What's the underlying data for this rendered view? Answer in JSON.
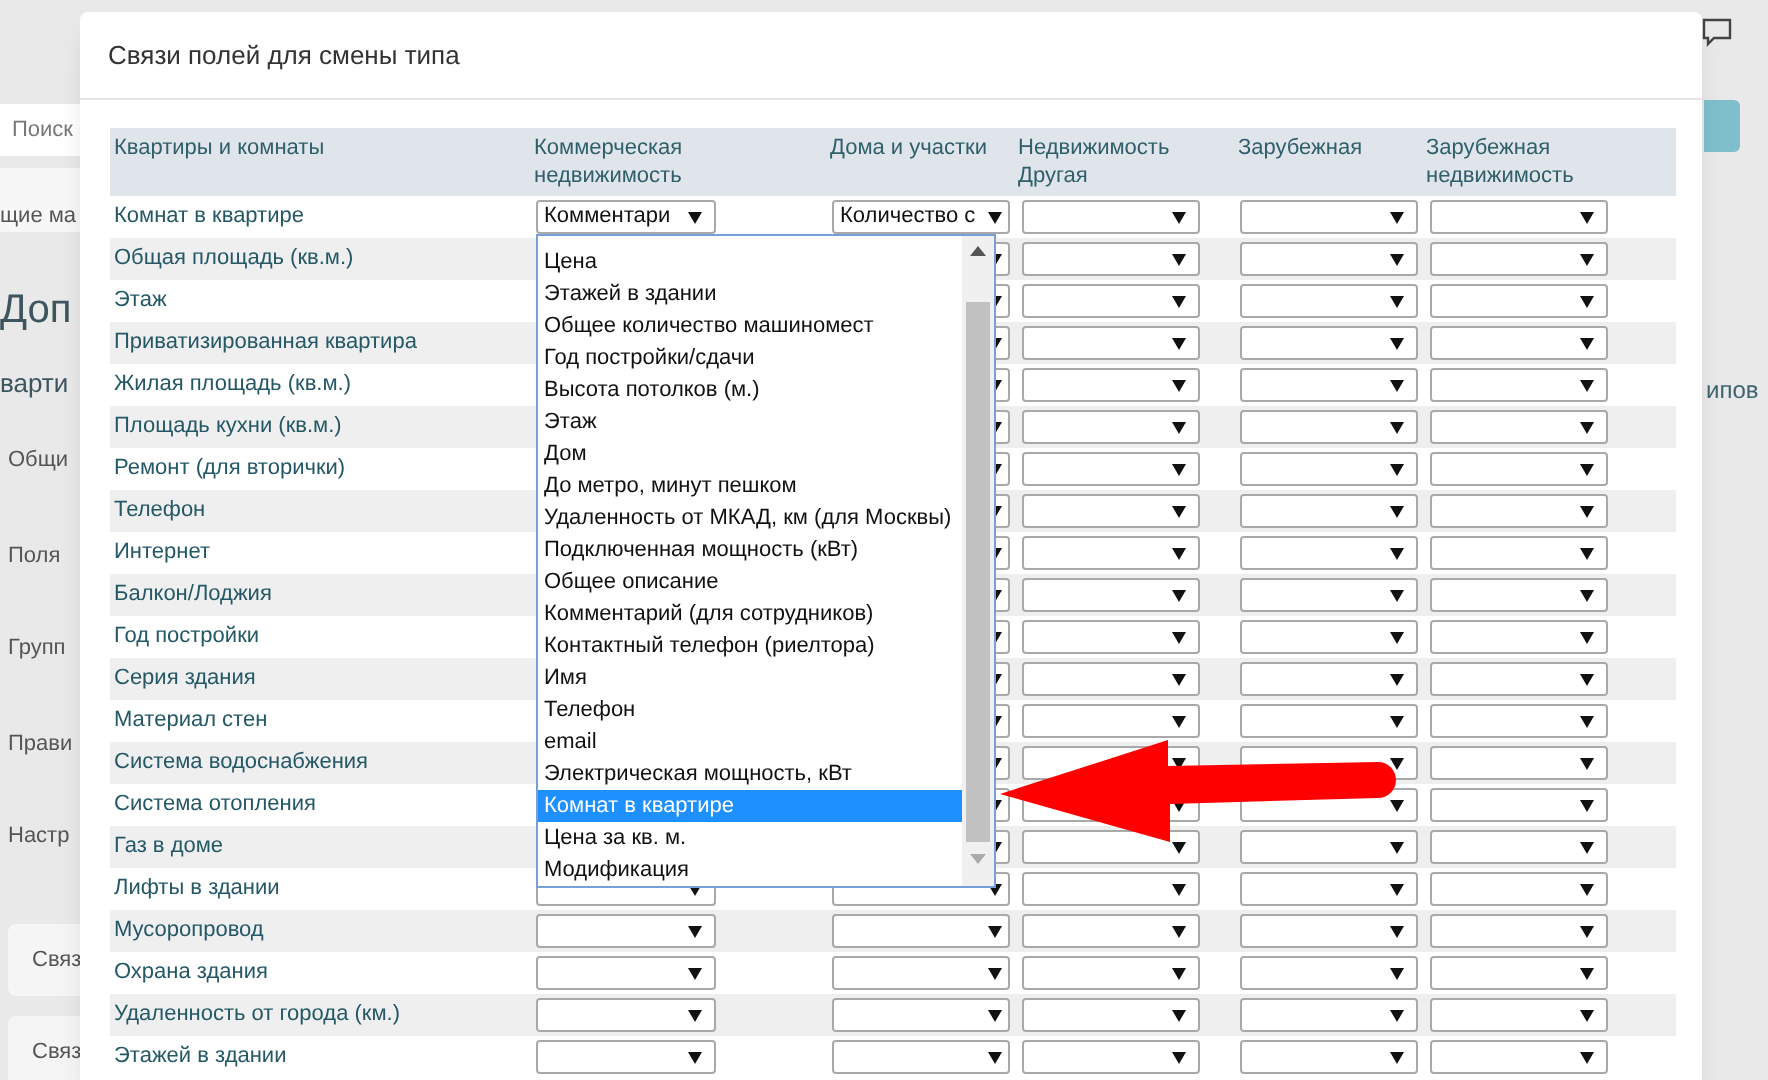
{
  "background": {
    "search_placeholder": "Поиск",
    "left_texts": [
      {
        "kind": "small",
        "text": "щие ма"
      },
      {
        "kind": "heading",
        "text": "Доп"
      },
      {
        "kind": "subheading",
        "text": "варти"
      },
      {
        "kind": "nav",
        "text": "Общи"
      },
      {
        "kind": "nav",
        "text": "Поля"
      },
      {
        "kind": "nav",
        "text": "Групп"
      },
      {
        "kind": "nav",
        "text": "Прави"
      },
      {
        "kind": "nav",
        "text": "Настр"
      },
      {
        "kind": "card",
        "text": "Связ"
      },
      {
        "kind": "card",
        "text": "Связ"
      }
    ],
    "right_text": "ипов"
  },
  "dialog": {
    "title": "Связи полей для смены типа",
    "columns": [
      "Квартиры и комнаты",
      "Коммерческая недвижимость",
      "Дома и участки",
      "Недвижимость Другая",
      "Зарубежная",
      "Зарубежная недвижимость"
    ],
    "rows": [
      {
        "label": "Комнат в квартире",
        "values": [
          "Комментари",
          "Количество с"
        ],
        "open_list": {
          "items": [
            {
              "label": "Цена",
              "selected": false
            },
            {
              "label": "Этажей в здании",
              "selected": false
            },
            {
              "label": "Общее количество машиномест",
              "selected": false
            },
            {
              "label": "Год постройки/сдачи",
              "selected": false
            },
            {
              "label": "Высота потолков (м.)",
              "selected": false
            },
            {
              "label": "Этаж",
              "selected": false
            },
            {
              "label": "Дом",
              "selected": false
            },
            {
              "label": "До метро, минут пешком",
              "selected": false
            },
            {
              "label": "Удаленность от МКАД, км (для Москвы)",
              "selected": false
            },
            {
              "label": "Подключенная мощность (кВт)",
              "selected": false
            },
            {
              "label": "Общее описание",
              "selected": false
            },
            {
              "label": "Комментарий (для сотрудников)",
              "selected": false
            },
            {
              "label": "Контактный телефон (риелтора)",
              "selected": false
            },
            {
              "label": "Имя",
              "selected": false
            },
            {
              "label": "Телефон",
              "selected": false
            },
            {
              "label": "email",
              "selected": false
            },
            {
              "label": "Электрическая мощность, кВт",
              "selected": false
            },
            {
              "label": "Комнат в квартире",
              "selected": true
            },
            {
              "label": "Цена за кв. м.",
              "selected": false
            },
            {
              "label": "Модификация",
              "selected": false
            }
          ]
        }
      },
      {
        "label": "Общая площадь (кв.м.)"
      },
      {
        "label": "Этаж"
      },
      {
        "label": "Приватизированная квартира"
      },
      {
        "label": "Жилая площадь (кв.м.)"
      },
      {
        "label": "Площадь кухни (кв.м.)"
      },
      {
        "label": "Ремонт (для вторички)"
      },
      {
        "label": "Телефон"
      },
      {
        "label": "Интернет"
      },
      {
        "label": "Балкон/Лоджия"
      },
      {
        "label": "Год постройки"
      },
      {
        "label": "Серия здания"
      },
      {
        "label": "Материал стен"
      },
      {
        "label": "Система водоснабжения"
      },
      {
        "label": "Система отопления"
      },
      {
        "label": "Газ в доме"
      },
      {
        "label": "Лифты в здании"
      },
      {
        "label": "Мусоропровод"
      },
      {
        "label": "Охрана здания"
      },
      {
        "label": "Удаленность от города (км.)"
      },
      {
        "label": "Этажей в здании"
      }
    ]
  }
}
